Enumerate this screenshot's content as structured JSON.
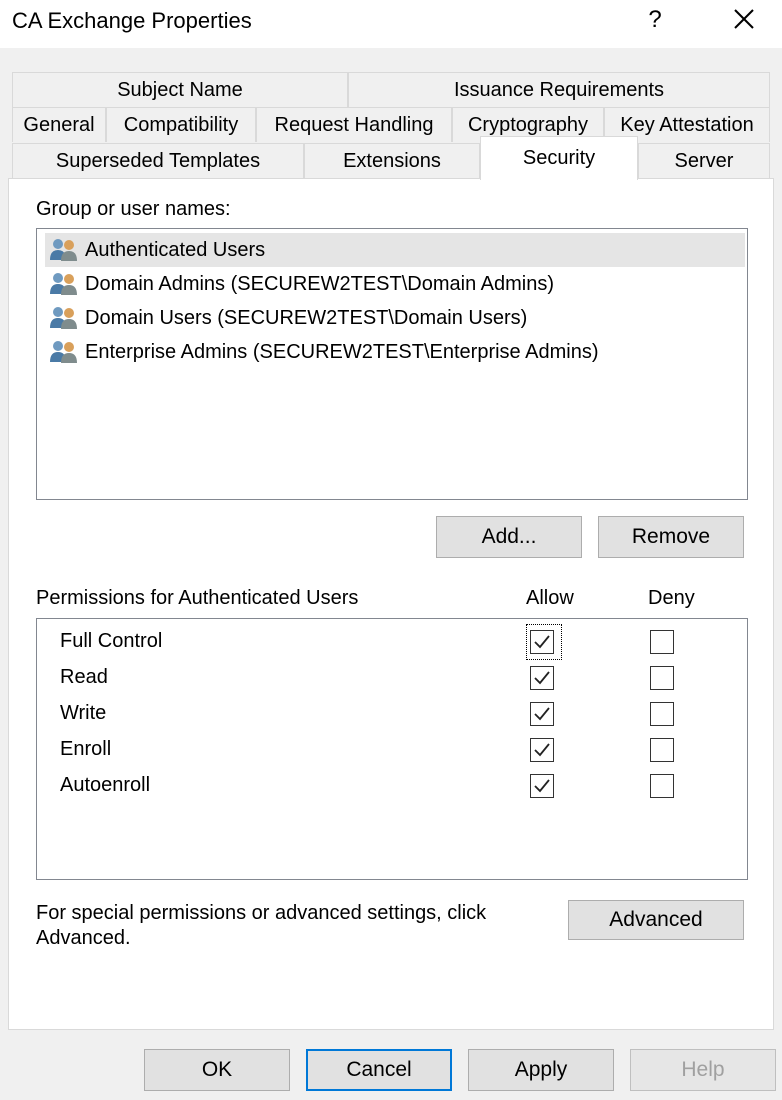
{
  "window": {
    "title": "CA Exchange Properties",
    "help_label": "?"
  },
  "tabs": {
    "row1": [
      "Subject Name",
      "Issuance Requirements"
    ],
    "row2": [
      "General",
      "Compatibility",
      "Request Handling",
      "Cryptography",
      "Key Attestation"
    ],
    "row3": [
      "Superseded Templates",
      "Extensions",
      "Security",
      "Server"
    ],
    "selected": "Security"
  },
  "security": {
    "group_label": "Group or user names:",
    "users": [
      {
        "name": "Authenticated Users",
        "selected": true
      },
      {
        "name": "Domain Admins (SECUREW2TEST\\Domain Admins)",
        "selected": false
      },
      {
        "name": "Domain Users (SECUREW2TEST\\Domain Users)",
        "selected": false
      },
      {
        "name": "Enterprise Admins (SECUREW2TEST\\Enterprise Admins)",
        "selected": false
      }
    ],
    "add_label": "Add...",
    "remove_label": "Remove",
    "permissions_label": "Permissions for Authenticated Users",
    "allow_header": "Allow",
    "deny_header": "Deny",
    "permissions": [
      {
        "name": "Full Control",
        "allow": true,
        "deny": false
      },
      {
        "name": "Read",
        "allow": true,
        "deny": false
      },
      {
        "name": "Write",
        "allow": true,
        "deny": false
      },
      {
        "name": "Enroll",
        "allow": true,
        "deny": false
      },
      {
        "name": "Autoenroll",
        "allow": true,
        "deny": false
      }
    ],
    "advanced_note_line1": "For special permissions or advanced settings, click",
    "advanced_note_line2": "Advanced.",
    "advanced_label": "Advanced"
  },
  "footer": {
    "ok_label": "OK",
    "cancel_label": "Cancel",
    "apply_label": "Apply",
    "help_label": "Help",
    "help_enabled": false
  },
  "colors": {
    "accent": "#0078d7",
    "selection": "#e5e5e5",
    "window_bg": "#f0f0f0"
  }
}
